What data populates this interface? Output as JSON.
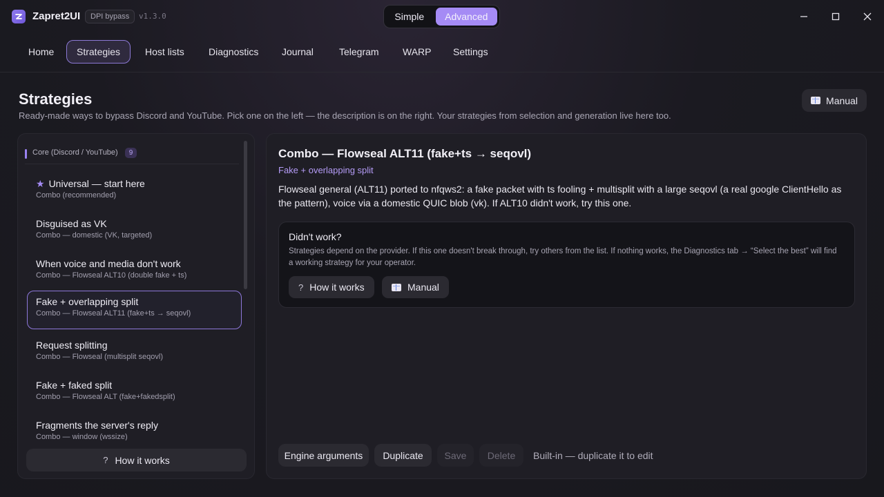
{
  "app": {
    "name": "Zapret2UI",
    "badge": "DPI bypass",
    "version": "v1.3.0",
    "accent_color": "#a58bf5"
  },
  "mode_toggle": {
    "simple": "Simple",
    "advanced": "Advanced",
    "selected": "Advanced"
  },
  "window_controls": [
    "minimize-icon",
    "maximize-icon",
    "close-icon"
  ],
  "nav": {
    "items": [
      {
        "label": "Home"
      },
      {
        "label": "Strategies"
      },
      {
        "label": "Host lists"
      },
      {
        "label": "Diagnostics"
      },
      {
        "label": "Journal"
      },
      {
        "label": "Telegram"
      },
      {
        "label": "WARP"
      },
      {
        "label": "Settings"
      }
    ],
    "active": "Strategies"
  },
  "header": {
    "title": "Strategies",
    "subtitle": "Ready-made ways to bypass Discord and YouTube. Pick one on the left — the description is on the right. Your strategies from selection and generation live here too.",
    "manual_button": "Manual",
    "manual_icon": "book-icon"
  },
  "strategy_group": {
    "title": "Core (Discord / YouTube)",
    "count": "9",
    "items": [
      {
        "title": "Universal — start here",
        "subtitle": "Combo (recommended)",
        "starred": true
      },
      {
        "title": "Disguised as VK",
        "subtitle": "Combo — domestic (VK, targeted)"
      },
      {
        "title": "When voice and media don't work",
        "subtitle": "Combo — Flowseal ALT10 (double fake + ts)"
      },
      {
        "title": "Fake + overlapping split",
        "subtitle": "Combo — Flowseal ALT11 (fake+ts → seqovl)",
        "selected": true
      },
      {
        "title": "Request splitting",
        "subtitle": "Combo — Flowseal (multisplit seqovl)"
      },
      {
        "title": "Fake + faked split",
        "subtitle": "Combo — Flowseal ALT (fake+fakedsplit)"
      },
      {
        "title": "Fragments the server's reply",
        "subtitle": "Combo — window (wssize)"
      }
    ],
    "how_it_works": "How it works"
  },
  "detail": {
    "title": "Combo — Flowseal ALT11 (fake+ts → seqovl)",
    "subtitle": "Fake + overlapping split",
    "description": "Flowseal general (ALT11) ported to nfqws2: a fake packet with ts fooling + multisplit with a large seqovl (a real google ClientHello as the pattern), voice via a domestic QUIC blob (vk). If ALT10 didn't work, try this one.",
    "help": {
      "title": "Didn't work?",
      "text": "Strategies depend on the provider. If this one doesn't break through, try others from the list. If nothing works, the Diagnostics tab → “Select the best” will find a working strategy for your operator.",
      "how_button": "How it works",
      "manual_button": "Manual"
    },
    "actions": {
      "engine_args": "Engine arguments",
      "duplicate": "Duplicate",
      "save": "Save",
      "delete": "Delete",
      "note": "Built-in — duplicate it to edit"
    }
  }
}
